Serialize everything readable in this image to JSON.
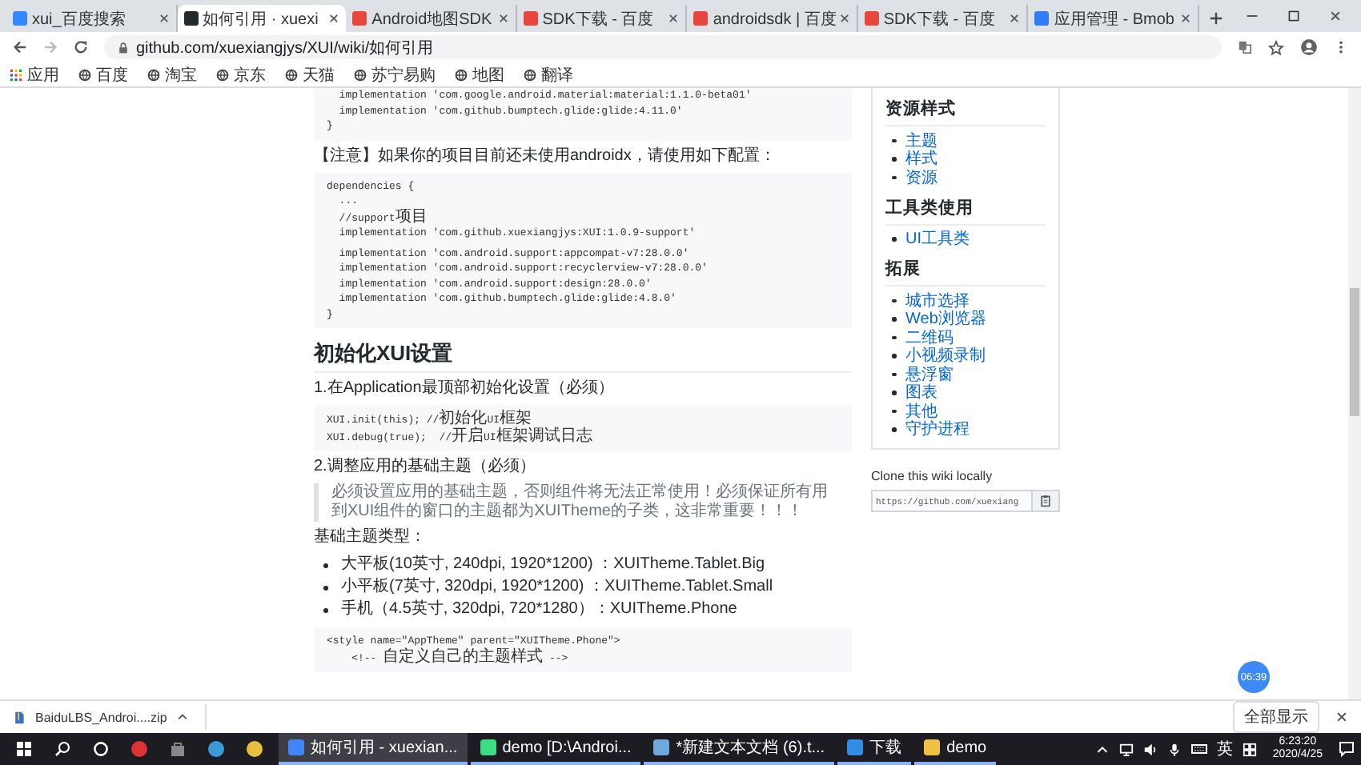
{
  "browser": {
    "tabs": [
      {
        "title": "xui_百度搜索",
        "selected": false,
        "color": "#3388ff"
      },
      {
        "title": "如何引用 · xuexi",
        "selected": true,
        "color": "#24292e"
      },
      {
        "title": "Android地图SDK",
        "selected": false,
        "color": "#e8453c"
      },
      {
        "title": "SDK下载 - 百度",
        "selected": false,
        "color": "#e8453c"
      },
      {
        "title": "androidsdk | 百度",
        "selected": false,
        "color": "#e8453c"
      },
      {
        "title": "SDK下载 - 百度",
        "selected": false,
        "color": "#e8453c"
      },
      {
        "title": "应用管理 - Bmob",
        "selected": false,
        "color": "#2f7cf6"
      }
    ],
    "address": "github.com/xuexiangjys/XUI/wiki/如何引用",
    "apps_label": "应用",
    "bookmarks": [
      "百度",
      "淘宝",
      "京东",
      "天猫",
      "苏宁易购",
      "地图",
      "翻译"
    ]
  },
  "page": {
    "blocks": [
      {
        "kind": "code",
        "sections": [
          [
            "  implementation 'com.google.android.material:material:1.1.0-beta01'",
            "  implementation 'com.github.bumptech.glide:glide:4.11.0'",
            "}"
          ]
        ]
      },
      {
        "kind": "paragraph",
        "text": "【注意】如果你的项目目前还未使用androidx，请使用如下配置："
      },
      {
        "kind": "code",
        "sections": [
          [
            "dependencies {",
            "  ...",
            "  //support项目",
            "  implementation 'com.github.xuexiangjys:XUI:1.0.9-support'"
          ],
          [
            "  implementation 'com.android.support:appcompat-v7:28.0.0'",
            "  implementation 'com.android.support:recyclerview-v7:28.0.0'",
            "  implementation 'com.android.support:design:28.0.0'",
            "  implementation 'com.github.bumptech.glide:glide:4.8.0'",
            "}"
          ]
        ]
      },
      {
        "kind": "heading",
        "text": "初始化XUI设置"
      },
      {
        "kind": "paragraph",
        "text": "1.在Application最顶部初始化设置（必须）"
      },
      {
        "kind": "code",
        "sections": [
          [
            "XUI.init(this); //初始化UI框架",
            "XUI.debug(true);  //开启UI框架调试日志"
          ]
        ]
      },
      {
        "kind": "paragraph",
        "text": "2.调整应用的基础主题（必须）"
      },
      {
        "kind": "quote",
        "text": "必须设置应用的基础主题，否则组件将无法正常使用！必须保证所有用到XUI组件的窗口的主题都为XUITheme的子类，这非常重要！！！"
      },
      {
        "kind": "paragraph",
        "text": "基础主题类型："
      },
      {
        "kind": "list",
        "items": [
          "大平板(10英寸, 240dpi, 1920*1200) ：XUITheme.Tablet.Big",
          "小平板(7英寸, 320dpi, 1920*1200) ：XUITheme.Tablet.Small",
          "手机（4.5英寸, 320dpi, 720*1280）：XUITheme.Phone"
        ]
      },
      {
        "kind": "code",
        "sections": [
          [
            "<style name=\"AppTheme\" parent=\"XUITheme.Phone\">",
            "    <!-- 自定义自己的主题样式 -->"
          ]
        ]
      }
    ],
    "sidebar": {
      "sections": [
        {
          "title": "资源样式",
          "items": [
            "主题",
            "样式",
            "资源"
          ]
        },
        {
          "title": "工具类使用",
          "items": [
            "UI工具类"
          ]
        },
        {
          "title": "拓展",
          "items": [
            "城市选择",
            "Web浏览器",
            "二维码",
            "小视频录制",
            "悬浮窗",
            "图表",
            "其他",
            "守护进程"
          ]
        }
      ]
    },
    "clone": {
      "title": "Clone this wiki locally",
      "url": "https://github.com/xuexiang"
    },
    "timer_badge": "06:39"
  },
  "downloads": {
    "file": "BaiduLBS_Androi....zip",
    "show_all": "全部显示"
  },
  "taskbar": {
    "items": [
      {
        "label": "如何引用 - xuexian...",
        "selected": true,
        "color": "#4285f4"
      },
      {
        "label": "demo [D:\\Androi...",
        "selected": false,
        "color": "#3ddc84"
      },
      {
        "label": "*新建文本文档 (6).t...",
        "selected": false,
        "color": "#6fa8dc"
      },
      {
        "label": "下载",
        "selected": false,
        "color": "#2f8de4"
      },
      {
        "label": "demo",
        "selected": false,
        "color": "#f0c040"
      }
    ],
    "ime": "英",
    "time": "6:23:20",
    "date": "2020/4/25"
  }
}
